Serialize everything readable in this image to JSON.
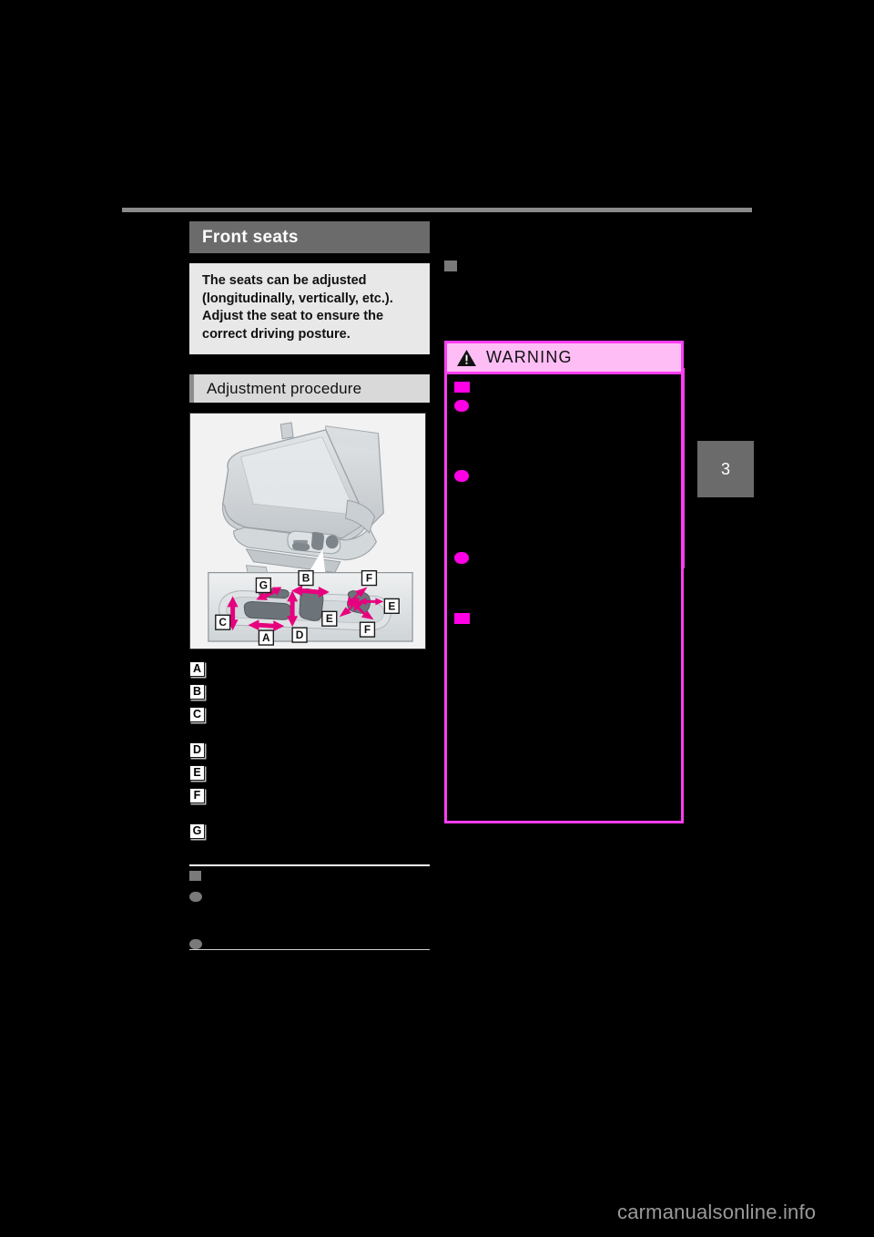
{
  "page": {
    "background_color": "#000000",
    "chapter_tab": "3",
    "watermark": "carmanualsonline.info"
  },
  "left_column": {
    "section_title": "Front seats",
    "lead_paragraph": "The seats can be adjusted (longitudinally, vertically, etc.). Adjust the seat to ensure the correct driving posture.",
    "subsection_title": "Adjustment procedure",
    "illustration": {
      "alt": "front seat with power adjustment switches, detail inset of switch panel",
      "arrow_color": "#e6007e",
      "inset_labels": [
        "A",
        "B",
        "C",
        "D",
        "E",
        "F",
        "G"
      ]
    },
    "callouts": [
      {
        "marker": "A",
        "text": "",
        "gap_before": false
      },
      {
        "marker": "B",
        "text": "",
        "gap_before": false
      },
      {
        "marker": "C",
        "text": "",
        "gap_before": false
      },
      {
        "marker": "D",
        "text": "",
        "gap_before": true
      },
      {
        "marker": "E",
        "text": "",
        "gap_before": false
      },
      {
        "marker": "F",
        "text": "",
        "gap_before": false
      },
      {
        "marker": "G",
        "text": "",
        "gap_before": true
      }
    ],
    "notice": {
      "heading": "",
      "bullets": [
        {
          "text": ""
        },
        {
          "text": ""
        }
      ]
    }
  },
  "right_column": {
    "note": {
      "text": ""
    },
    "warning": {
      "title": "WARNING",
      "icon": "warning-triangle-icon",
      "border_color": "#ff3df2",
      "header_background": "#ffbdf6",
      "bullet_color": "#ff00e6",
      "items": [
        {
          "marker": "square",
          "text": ""
        },
        {
          "marker": "circle",
          "text": ""
        },
        {
          "marker": "circle",
          "text": ""
        },
        {
          "marker": "circle",
          "text": ""
        },
        {
          "marker": "square",
          "text": ""
        }
      ]
    }
  }
}
